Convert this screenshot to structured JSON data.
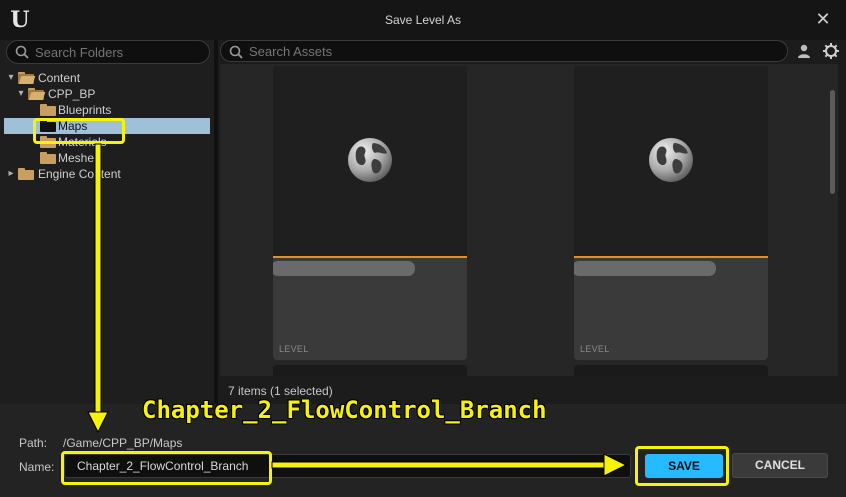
{
  "window": {
    "title": "Save Level As",
    "close_glyph": "✕",
    "logo_glyph": "U"
  },
  "left": {
    "search_placeholder": "Search Folders",
    "tree": [
      {
        "label": "Content",
        "caret": "▾"
      },
      {
        "label": "CPP_BP",
        "caret": "▾"
      },
      {
        "label": "Blueprints"
      },
      {
        "label": "Maps",
        "selected": true
      },
      {
        "label": "Materials"
      },
      {
        "label": "Meshes"
      },
      {
        "label": "Engine Content",
        "caret": "▸"
      }
    ]
  },
  "right": {
    "search_placeholder": "Search Assets",
    "tiles": [
      {
        "type_label": "LEVEL"
      },
      {
        "type_label": "LEVEL"
      }
    ],
    "status": "7 items (1 selected)"
  },
  "bottom": {
    "path_label": "Path:",
    "path_value": "/Game/CPP_BP/Maps",
    "name_label": "Name:",
    "name_value": "Chapter_2_FlowControl_Branch",
    "save_label": "SAVE",
    "cancel_label": "CANCEL"
  },
  "annotation": {
    "text": "Chapter_2_FlowControl_Branch",
    "color": "#f7f20a"
  },
  "colors": {
    "accent": "#26bbff",
    "selection": "#9fc0d6",
    "tile_accent": "#e0902a",
    "folder": "#c89f61"
  }
}
